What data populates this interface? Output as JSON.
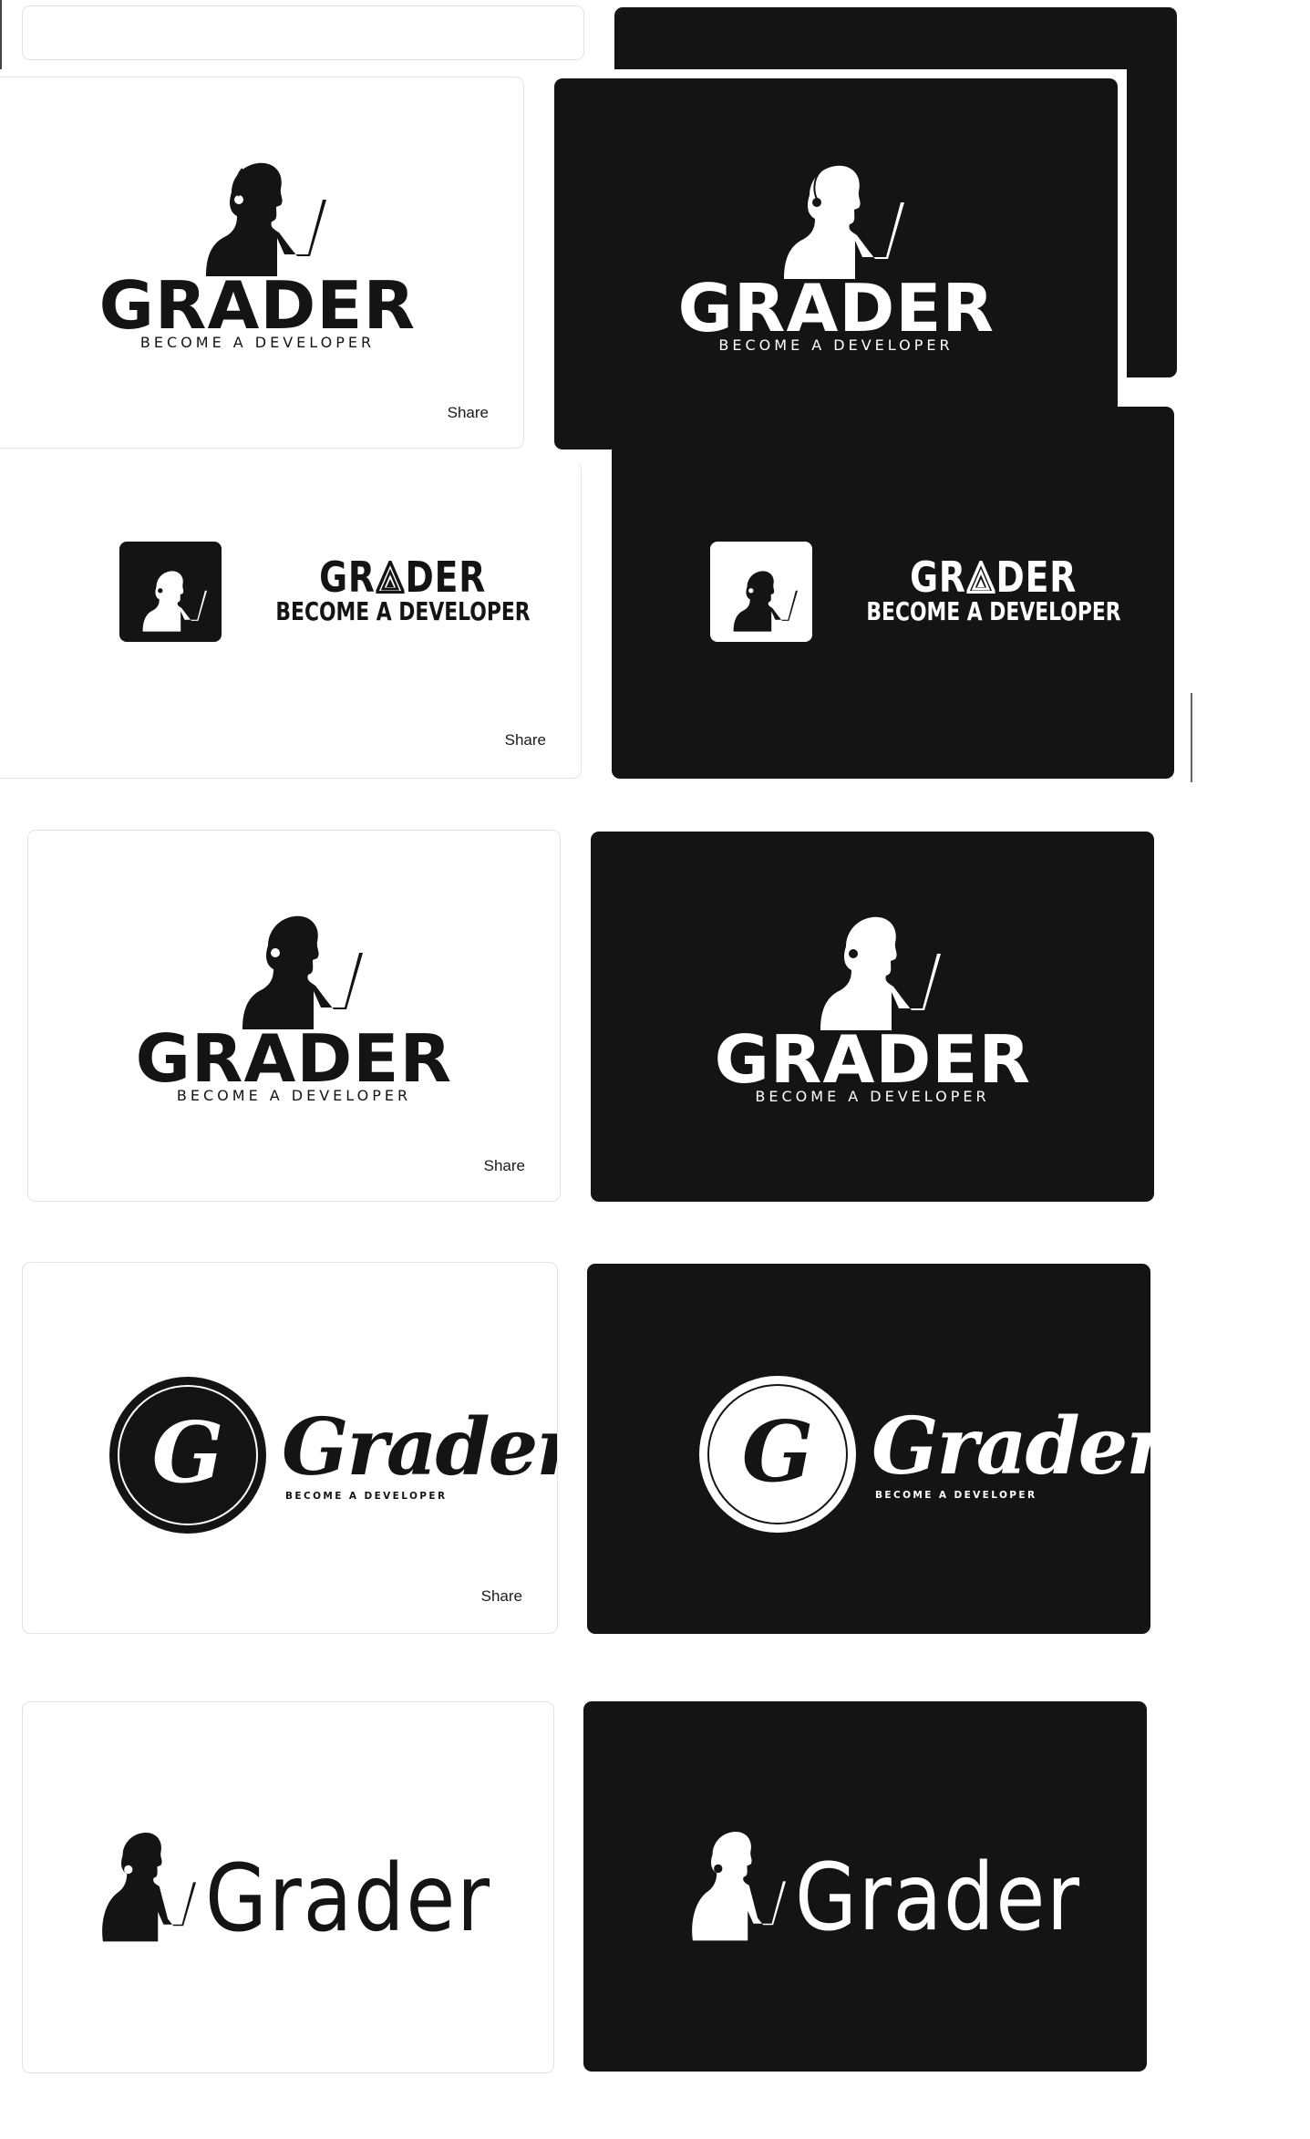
{
  "brand": {
    "name": "GRADER",
    "name_triangle": [
      "GR",
      "DER"
    ],
    "name_script": "Grader",
    "name_thin": "Grader",
    "tagline": "BECOME A DEVELOPER",
    "script_mark_letter": "G"
  },
  "share_label": "Share",
  "colors": {
    "dark_card": "#141414",
    "light_card": "#ffffff",
    "border": "#e3e3e3"
  },
  "icons": [
    "developer-silhouette-icon",
    "headset-icon",
    "laptop-icon",
    "triangle-a-icon",
    "g-circle-monogram-icon"
  ]
}
